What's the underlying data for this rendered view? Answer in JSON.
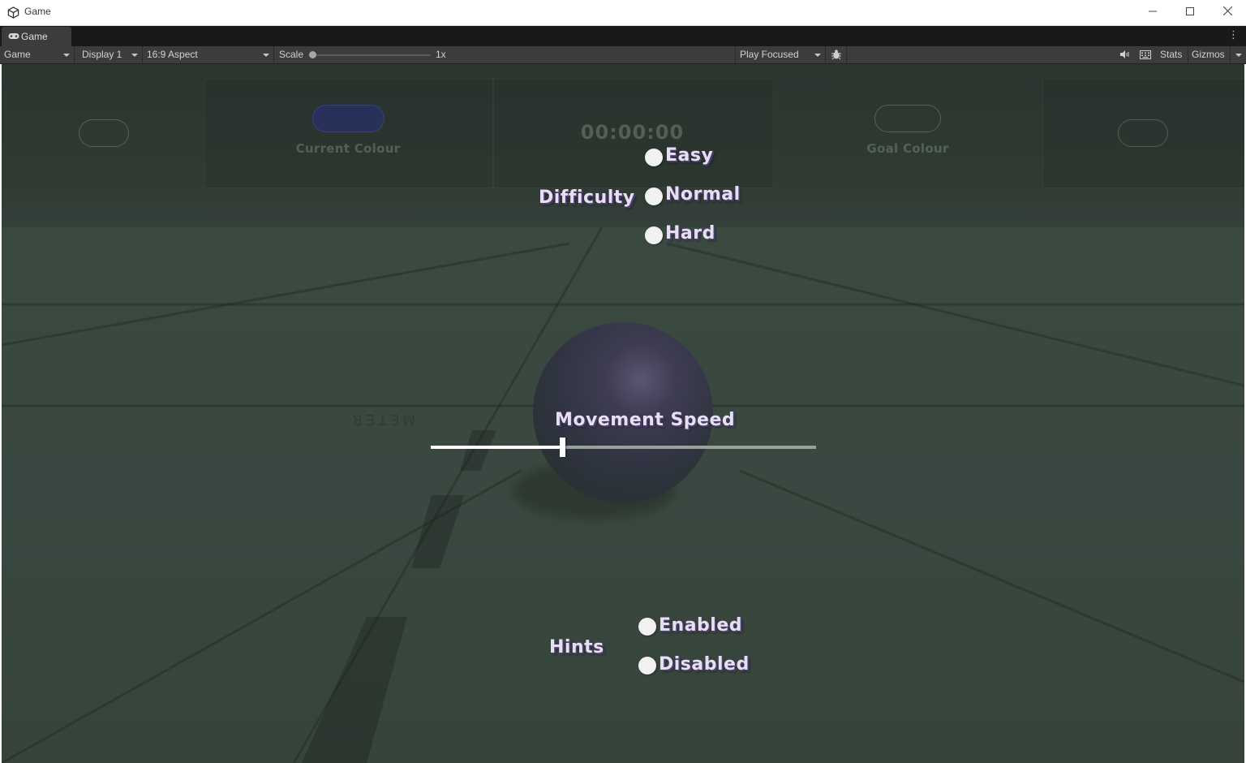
{
  "window": {
    "title": "Game"
  },
  "tab": {
    "label": "Game",
    "icon": "gamepad-icon",
    "menu_icon": "more-vertical-icon"
  },
  "toolbar": {
    "view_dropdown": "Game",
    "display_dropdown": "Display 1",
    "aspect_dropdown": "16:9 Aspect",
    "scale_label": "Scale",
    "scale_value": "1x",
    "scale_level": 0,
    "play_mode_dropdown": "Play Focused",
    "stats_button": "Stats",
    "gizmos_button": "Gizmos"
  },
  "hud": {
    "timer": "00:00:00",
    "current_colour_label": "Current Colour",
    "goal_colour_label": "Goal Colour",
    "current_colour_swatch": "#27315a"
  },
  "settings": {
    "difficulty": {
      "label": "Difficulty",
      "options": [
        "Easy",
        "Normal",
        "Hard"
      ]
    },
    "movement_speed": {
      "label": "Movement Speed",
      "value_fraction": 0.34
    },
    "hints": {
      "label": "Hints",
      "options": [
        "Enabled",
        "Disabled"
      ]
    }
  },
  "colors": {
    "editor_bg": "#3c3c3c",
    "viewport_floor": "#3a473d",
    "ui_text": "#e6dff2",
    "ui_text_shadow": "#4a3d6a"
  }
}
